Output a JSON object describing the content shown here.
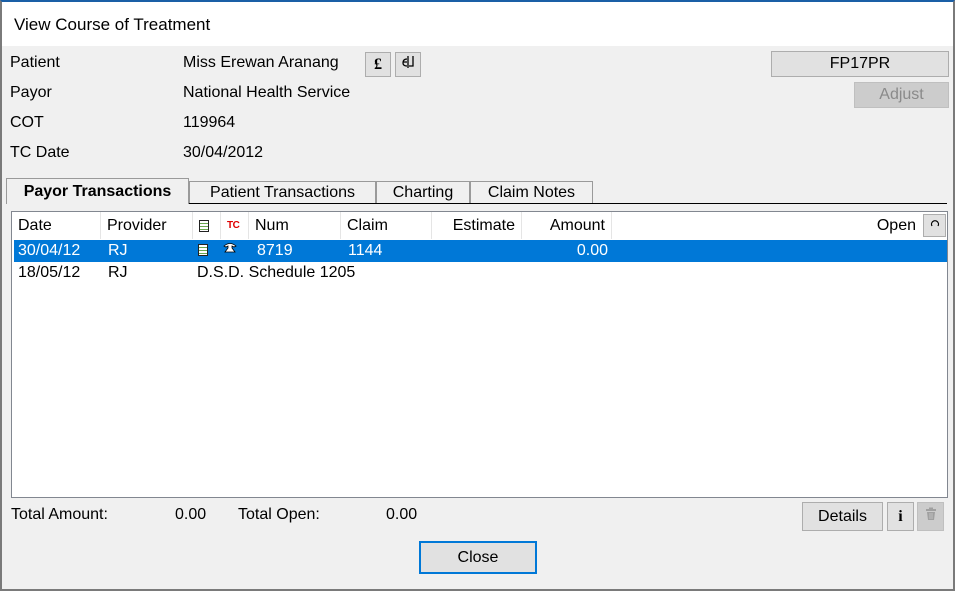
{
  "window": {
    "title": "View Course of Treatment"
  },
  "info": {
    "patient_label": "Patient",
    "patient_value": "Miss Erewan Aranang",
    "payor_label": "Payor",
    "payor_value": "National Health Service",
    "cot_label": "COT",
    "cot_value": "119964",
    "tcdate_label": "TC Date",
    "tcdate_value": "30/04/2012",
    "pound_button_glyph": "£",
    "split_button_glyph": "ꟈ"
  },
  "buttons": {
    "fp17pr": "FP17PR",
    "adjust": "Adjust",
    "details": "Details",
    "info": "i",
    "delete_icon": "trash-icon",
    "refresh_icon": "refresh-icon",
    "close": "Close"
  },
  "tabs": [
    {
      "label": "Payor Transactions",
      "active": true
    },
    {
      "label": "Patient Transactions",
      "active": false
    },
    {
      "label": "Charting",
      "active": false
    },
    {
      "label": "Claim Notes",
      "active": false
    }
  ],
  "grid": {
    "columns": {
      "date": "Date",
      "provider": "Provider",
      "doc_icon": "document-icon",
      "tc": "TC",
      "num": "Num",
      "claim": "Claim",
      "estimate": "Estimate",
      "amount": "Amount",
      "open": "Open"
    },
    "rows": [
      {
        "date": "30/04/12",
        "provider": "RJ",
        "doc_icon": "document-icon",
        "tc_icon": "telephone-icon",
        "num": "8719",
        "claim": "1144",
        "estimate": "",
        "amount": "0.00",
        "open": "",
        "selected": true
      },
      {
        "date": "18/05/12",
        "provider": "RJ",
        "description": "D.S.D. Schedule 1205",
        "selected": false
      }
    ]
  },
  "totals": {
    "total_amount_label": "Total Amount:",
    "total_amount_value": "0.00",
    "total_open_label": "Total Open:",
    "total_open_value": "0.00"
  },
  "colors": {
    "selection": "#0078d7",
    "tc_red": "#e00000",
    "window_bg": "#f0f0f0"
  }
}
